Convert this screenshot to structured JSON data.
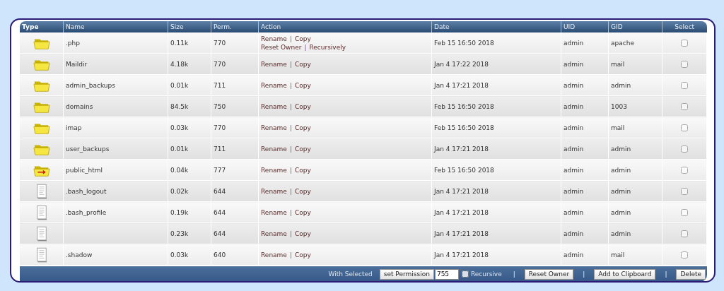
{
  "table": {
    "columns": [
      "Type",
      "Name",
      "Size",
      "Perm.",
      "Action",
      "Date",
      "UID",
      "GID",
      "Select"
    ],
    "separator": "|",
    "rows": [
      {
        "kind": "folder",
        "name": ".php",
        "size": "0.11k",
        "perm": "770",
        "actions": [
          [
            "Rename",
            "Copy"
          ],
          [
            "Reset Owner",
            "Recursively"
          ]
        ],
        "date": "Feb 15 16:50 2018",
        "uid": "admin",
        "gid": "apache",
        "checked": false
      },
      {
        "kind": "folder",
        "name": "Maildir",
        "size": "4.18k",
        "perm": "770",
        "actions": [
          [
            "Rename",
            "Copy"
          ]
        ],
        "date": "Jan 4 17:22 2018",
        "uid": "admin",
        "gid": "mail",
        "checked": false
      },
      {
        "kind": "folder",
        "name": "admin_backups",
        "size": "0.01k",
        "perm": "711",
        "actions": [
          [
            "Rename",
            "Copy"
          ]
        ],
        "date": "Jan 4 17:21 2018",
        "uid": "admin",
        "gid": "admin",
        "checked": false
      },
      {
        "kind": "folder",
        "name": "domains",
        "size": "84.5k",
        "perm": "750",
        "actions": [
          [
            "Rename",
            "Copy"
          ]
        ],
        "date": "Feb 15 16:50 2018",
        "uid": "admin",
        "gid": "1003",
        "checked": false
      },
      {
        "kind": "folder",
        "name": "imap",
        "size": "0.03k",
        "perm": "770",
        "actions": [
          [
            "Rename",
            "Copy"
          ]
        ],
        "date": "Feb 15 16:50 2018",
        "uid": "admin",
        "gid": "mail",
        "checked": false
      },
      {
        "kind": "folder",
        "name": "user_backups",
        "size": "0.01k",
        "perm": "711",
        "actions": [
          [
            "Rename",
            "Copy"
          ]
        ],
        "date": "Jan 4 17:21 2018",
        "uid": "admin",
        "gid": "admin",
        "checked": false
      },
      {
        "kind": "link",
        "name": "public_html",
        "size": "0.04k",
        "perm": "777",
        "actions": [
          [
            "Rename",
            "Copy"
          ]
        ],
        "date": "Feb 15 16:50 2018",
        "uid": "admin",
        "gid": "admin",
        "checked": false
      },
      {
        "kind": "file",
        "name": ".bash_logout",
        "size": "0.02k",
        "perm": "644",
        "actions": [
          [
            "Rename",
            "Copy"
          ]
        ],
        "date": "Jan 4 17:21 2018",
        "uid": "admin",
        "gid": "admin",
        "checked": false
      },
      {
        "kind": "file",
        "name": ".bash_profile",
        "size": "0.19k",
        "perm": "644",
        "actions": [
          [
            "Rename",
            "Copy"
          ]
        ],
        "date": "Jan 4 17:21 2018",
        "uid": "admin",
        "gid": "admin",
        "checked": false
      },
      {
        "kind": "file",
        "size": "0.23k",
        "perm": "644",
        "actions": [
          [
            "Rename",
            "Copy"
          ]
        ],
        "date": "Jan 4 17:21 2018",
        "uid": "admin",
        "gid": "admin",
        "checked": false
      },
      {
        "kind": "file",
        "name": ".shadow",
        "size": "0.03k",
        "perm": "640",
        "actions": [
          [
            "Rename",
            "Copy"
          ]
        ],
        "date": "Jan 4 17:21 2018",
        "uid": "admin",
        "gid": "mail",
        "checked": false
      }
    ]
  },
  "footer": [
    {
      "kind": "label",
      "text": "With Selected"
    },
    {
      "kind": "button",
      "text": "set Permission"
    },
    {
      "kind": "input",
      "value": "755"
    },
    {
      "kind": "checkbox",
      "text": "Recursive",
      "checked": false
    },
    {
      "kind": "separator",
      "text": "|"
    },
    {
      "kind": "button",
      "text": "Reset Owner"
    },
    {
      "kind": "separator",
      "text": "|"
    },
    {
      "kind": "button",
      "text": "Add to Clipboard"
    },
    {
      "kind": "separator",
      "text": "|"
    },
    {
      "kind": "button",
      "text": "Delete"
    }
  ]
}
